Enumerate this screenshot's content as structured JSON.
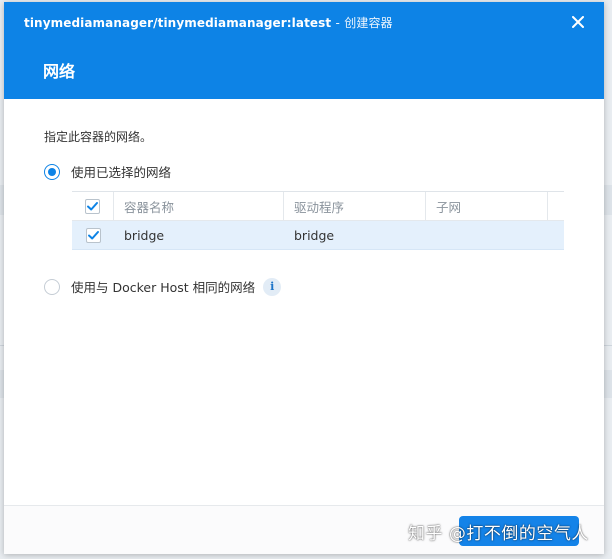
{
  "window": {
    "app_title": "tinymediamanager/tinymediamanager:latest",
    "title_separator": "-",
    "title_sub": "创建容器",
    "heading": "网络"
  },
  "network": {
    "description": "指定此容器的网络。",
    "option_selected": "使用已选择的网络",
    "option_host": "使用与 Docker Host 相同的网络",
    "info_glyph": "i",
    "table": {
      "columns": [
        "容器名称",
        "驱动程序",
        "子网"
      ],
      "rows": [
        {
          "name": "bridge",
          "driver": "bridge",
          "subnet": "",
          "checked": true
        }
      ]
    }
  },
  "watermark": {
    "text": "知乎 @打不倒的空气人"
  },
  "colors": {
    "accent": "#0d83e6",
    "header_bg": "#0d83e6",
    "selected_row": "#e4f0fc"
  }
}
